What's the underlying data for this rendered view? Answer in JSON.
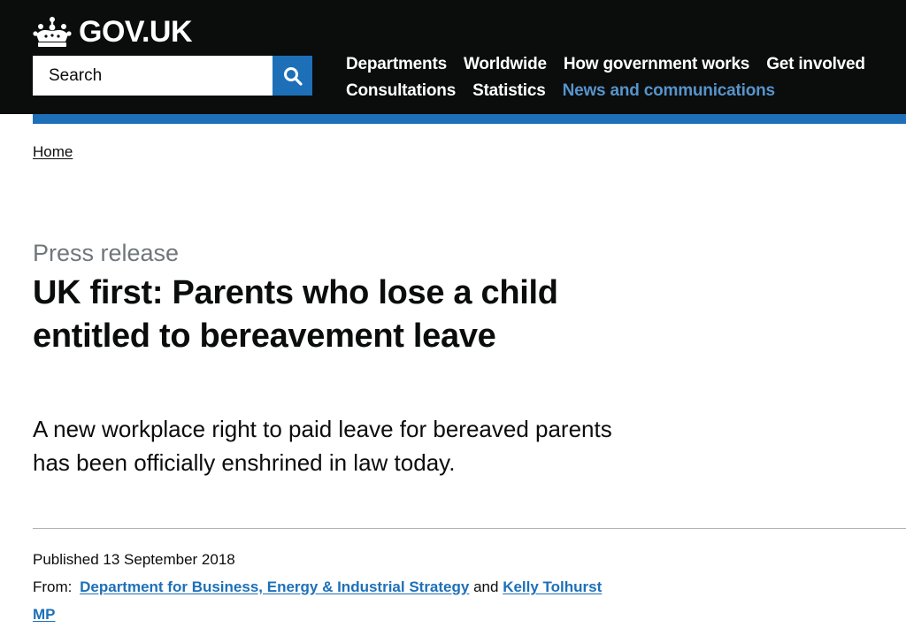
{
  "header": {
    "logo_text": "GOV.UK",
    "logo_icon": "crown-icon",
    "search": {
      "placeholder": "Search",
      "button_icon": "search-icon"
    },
    "nav": [
      {
        "label": "Departments"
      },
      {
        "label": "Worldwide"
      },
      {
        "label": "How government works"
      },
      {
        "label": "Get involved"
      },
      {
        "label": "Consultations"
      },
      {
        "label": "Statistics"
      },
      {
        "label": "News and communications",
        "active": true
      }
    ]
  },
  "breadcrumb": {
    "home": "Home"
  },
  "article": {
    "document_type": "Press release",
    "title": "UK first: Parents who lose a child entitled to bereavement leave",
    "lede": "A new workplace right to paid leave for bereaved parents has been officially enshrined in law today.",
    "published_label": "Published",
    "published_date": "13 September 2018",
    "from_label": "From:",
    "from_links": [
      "Department for Business, Energy & Industrial Strategy",
      "Kelly Tolhurst MP"
    ],
    "from_joiner": "and"
  },
  "colors": {
    "header_background": "#0b0c0c",
    "brand_blue": "#1d70b8",
    "active_nav": "#5694ca",
    "secondary_text": "#6f777b",
    "divider": "#b1b4b6"
  }
}
